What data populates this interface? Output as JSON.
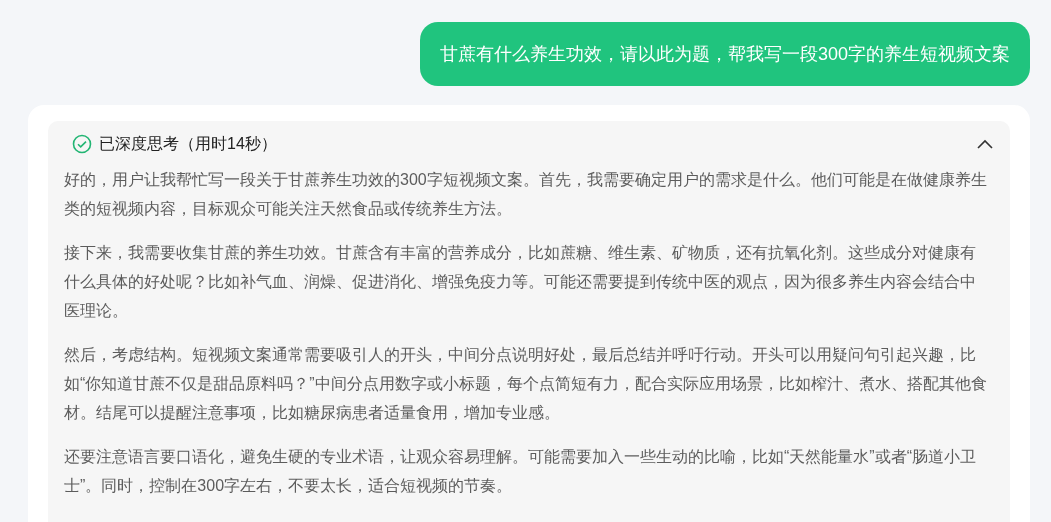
{
  "user_message": {
    "text": "甘蔗有什么养生功效，请以此为题，帮我写一段300字的养生短视频文案"
  },
  "thinking": {
    "title": "已深度思考（用时14秒）",
    "done": true,
    "expanded": true,
    "paragraphs": [
      "好的，用户让我帮忙写一段关于甘蔗养生功效的300字短视频文案。首先，我需要确定用户的需求是什么。他们可能是在做健康养生类的短视频内容，目标观众可能关注天然食品或传统养生方法。",
      "接下来，我需要收集甘蔗的养生功效。甘蔗含有丰富的营养成分，比如蔗糖、维生素、矿物质，还有抗氧化剂。这些成分对健康有什么具体的好处呢？比如补气血、润燥、促进消化、增强免疫力等。可能还需要提到传统中医的观点，因为很多养生内容会结合中医理论。",
      "然后，考虑结构。短视频文案通常需要吸引人的开头，中间分点说明好处，最后总结并呼吁行动。开头可以用疑问句引起兴趣，比如“你知道甘蔗不仅是甜品原料吗？”中间分点用数字或小标题，每个点简短有力，配合实际应用场景，比如榨汁、煮水、搭配其他食材。结尾可以提醒注意事项，比如糖尿病患者适量食用，增加专业感。",
      "还要注意语言要口语化，避免生硬的专业术语，让观众容易理解。可能需要加入一些生动的比喻，比如“天然能量水”或者“肠道小卫士”。同时，控制在300字左右，不要太长，适合短视频的节奏。"
    ]
  }
}
